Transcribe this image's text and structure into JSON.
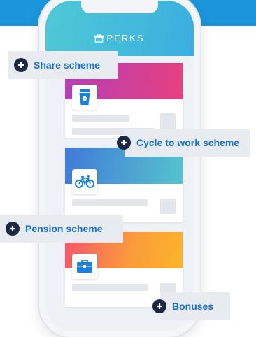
{
  "app": {
    "brand": "PERKS"
  },
  "perks": [
    {
      "key": "share",
      "label": "Share scheme",
      "icon": "coffee-cup-icon"
    },
    {
      "key": "cycle",
      "label": "Cycle to work scheme",
      "icon": "bicycle-icon"
    },
    {
      "key": "pension",
      "label": "Pension scheme"
    },
    {
      "key": "bonuses",
      "label": "Bonuses",
      "icon": "briefcase-icon"
    }
  ],
  "colors": {
    "top_bar": "#1c95dd",
    "header_gradient": [
      "#4fc9d6",
      "#3aaee0"
    ],
    "card1_gradient": [
      "#b43fb8",
      "#e7407f"
    ],
    "card2_gradient": [
      "#3f7ad8",
      "#57c3cf"
    ],
    "card3_gradient": [
      "#f7556a",
      "#fcb42c"
    ],
    "callout_text": "#1a72c8",
    "plus_badge": "#1d2746"
  }
}
